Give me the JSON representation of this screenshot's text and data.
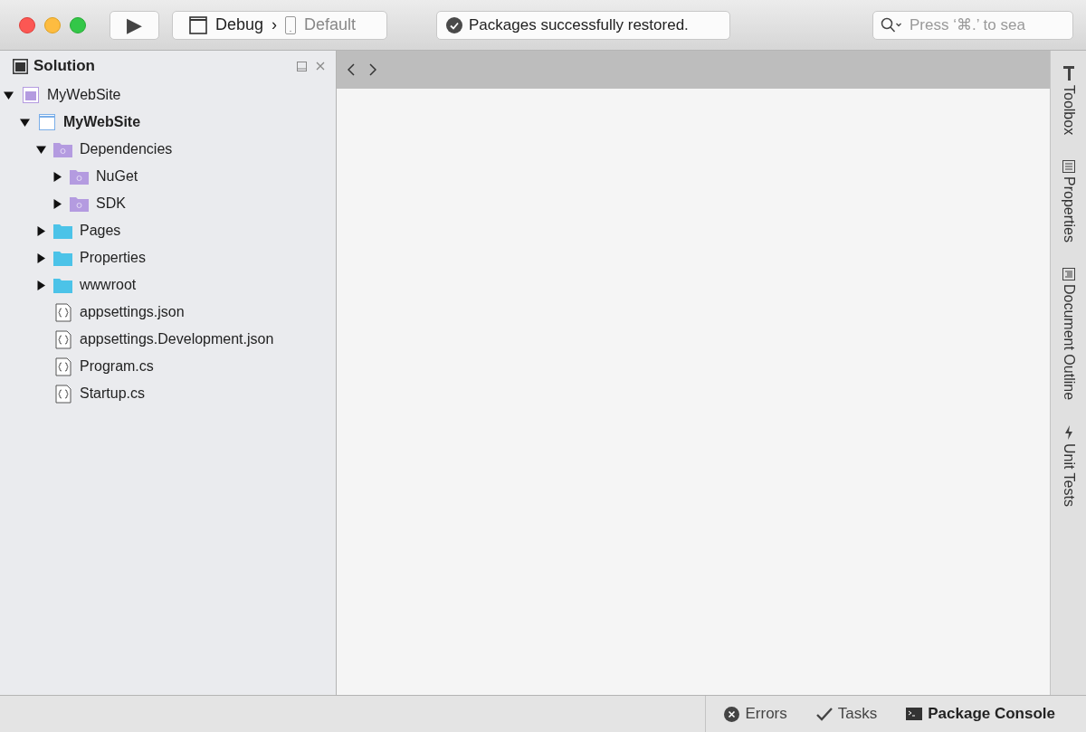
{
  "toolbar": {
    "run_button": {
      "label": "▶"
    },
    "configuration": {
      "name": "Debug",
      "separator": "›",
      "target": "Default"
    },
    "status": {
      "text": "Packages successfully restored."
    },
    "search": {
      "placeholder": "Press ‘⌘.’ to sea"
    }
  },
  "solution_pad": {
    "title": "Solution",
    "tree": [
      {
        "label": "MyWebSite",
        "kind": "solution",
        "expanded": true,
        "children": [
          {
            "label": "MyWebSite",
            "kind": "project",
            "expanded": true,
            "children": [
              {
                "label": "Dependencies",
                "kind": "dependency-folder",
                "expanded": true,
                "children": [
                  {
                    "label": "NuGet",
                    "kind": "dependency-folder",
                    "expanded": false
                  },
                  {
                    "label": "SDK",
                    "kind": "dependency-folder",
                    "expanded": false
                  }
                ]
              },
              {
                "label": "Pages",
                "kind": "folder",
                "expanded": false
              },
              {
                "label": "Properties",
                "kind": "folder",
                "expanded": false
              },
              {
                "label": "wwwroot",
                "kind": "folder",
                "expanded": false
              },
              {
                "label": "appsettings.json",
                "kind": "file"
              },
              {
                "label": "appsettings.Development.json",
                "kind": "file"
              },
              {
                "label": "Program.cs",
                "kind": "file"
              },
              {
                "label": "Startup.cs",
                "kind": "file"
              }
            ]
          }
        ]
      }
    ]
  },
  "side_tabs": [
    {
      "label": "Toolbox",
      "kind": "toolbox"
    },
    {
      "label": "Properties",
      "kind": "properties"
    },
    {
      "label": "Document Outline",
      "kind": "outline"
    },
    {
      "label": "Unit Tests",
      "kind": "tests"
    }
  ],
  "bottom_pads": [
    {
      "label": "Errors",
      "kind": "errors",
      "selected": false
    },
    {
      "label": "Tasks",
      "kind": "tasks",
      "selected": false
    },
    {
      "label": "Package Console",
      "kind": "console",
      "selected": true
    }
  ]
}
